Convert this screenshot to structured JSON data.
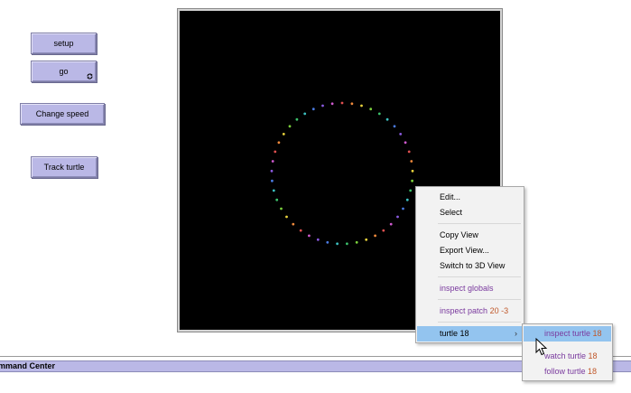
{
  "buttons": {
    "setup": "setup",
    "go": "go",
    "change_speed": "Change speed",
    "track_turtle": "Track turtle"
  },
  "command_center": {
    "title": "mmand Center"
  },
  "context_menu": {
    "edit": "Edit...",
    "select": "Select",
    "copy_view": "Copy View",
    "export_view": "Export View...",
    "switch_3d": "Switch to 3D View",
    "inspect_globals": "inspect globals",
    "inspect_patch_label": "inspect patch",
    "inspect_patch_coords": "20 -3",
    "turtle_label": "turtle",
    "turtle_id": "18"
  },
  "submenu": {
    "inspect_label": "inspect turtle",
    "watch_label": "watch turtle",
    "follow_label": "follow turtle",
    "turtle_id": "18"
  },
  "icons": {
    "forever": "forever-arrows-icon",
    "submenu_arrow": "chevron-right-icon",
    "cursor": "mouse-pointer-icon"
  },
  "colors": {
    "button_bg": "#bab8e6",
    "menu_highlight": "#93c4ef",
    "view_bg": "#000000",
    "turtle_colors": [
      "#e05050",
      "#f08a3c",
      "#e8d23c",
      "#7bd03c",
      "#3cc06a",
      "#3cc0c0",
      "#4a7ae0",
      "#8a5ae0",
      "#d05ad0"
    ]
  },
  "turtles": {
    "count": 45
  }
}
